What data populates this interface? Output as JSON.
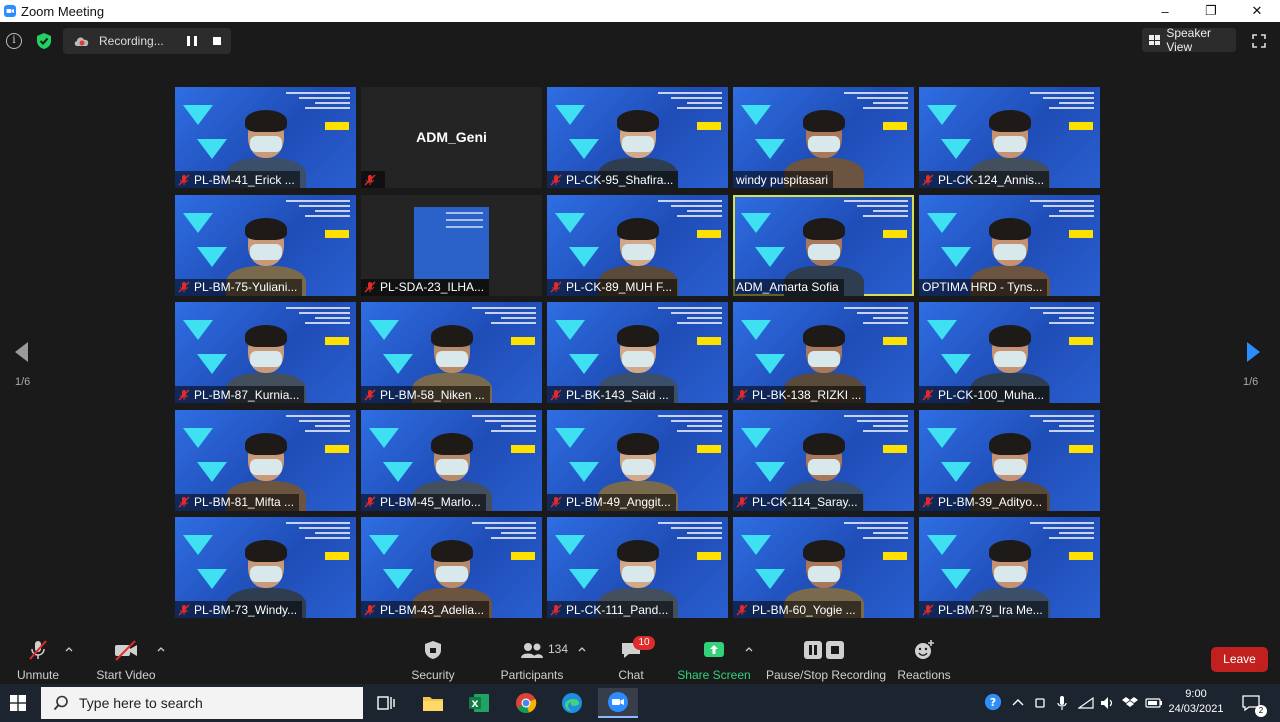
{
  "window": {
    "title": "Zoom Meeting",
    "controls": [
      "–",
      "❐",
      "✕"
    ]
  },
  "topbar": {
    "recording_label": "Recording...",
    "speaker_view_label": "Speaker View"
  },
  "gallery": {
    "page_left": "1/6",
    "page_right": "1/6",
    "tiles": [
      {
        "name": "PL-BM-41_Erick ...",
        "muted": true,
        "kind": "video"
      },
      {
        "name": "",
        "display_name": "ADM_Geni",
        "muted": true,
        "kind": "dark"
      },
      {
        "name": "PL-CK-95_Shafira...",
        "muted": true,
        "kind": "video"
      },
      {
        "name": "windy puspitasari",
        "muted": false,
        "kind": "video"
      },
      {
        "name": "PL-CK-124_Annis...",
        "muted": true,
        "kind": "video"
      },
      {
        "name": "PL-BM-75-Yuliani...",
        "muted": true,
        "kind": "video"
      },
      {
        "name": "PL-SDA-23_ILHA...",
        "muted": true,
        "kind": "dark-share"
      },
      {
        "name": "PL-CK-89_MUH F...",
        "muted": true,
        "kind": "video"
      },
      {
        "name": "ADM_Amarta Sofia",
        "muted": false,
        "kind": "video",
        "active": true
      },
      {
        "name": "OPTIMA HRD - Tyns...",
        "muted": false,
        "kind": "video"
      },
      {
        "name": "PL-BM-87_Kurnia...",
        "muted": true,
        "kind": "video"
      },
      {
        "name": "PL-BM-58_Niken ...",
        "muted": true,
        "kind": "video"
      },
      {
        "name": "PL-BK-143_Said ...",
        "muted": true,
        "kind": "video"
      },
      {
        "name": "PL-BK-138_RIZKI ...",
        "muted": true,
        "kind": "video"
      },
      {
        "name": "PL-CK-100_Muha...",
        "muted": true,
        "kind": "video"
      },
      {
        "name": "PL-BM-81_Mifta ...",
        "muted": true,
        "kind": "video"
      },
      {
        "name": "PL-BM-45_Marlo...",
        "muted": true,
        "kind": "video"
      },
      {
        "name": "PL-BM-49_Anggit...",
        "muted": true,
        "kind": "video"
      },
      {
        "name": "PL-CK-114_Saray...",
        "muted": true,
        "kind": "video"
      },
      {
        "name": "PL-BM-39_Adityo...",
        "muted": true,
        "kind": "video"
      },
      {
        "name": "PL-BM-73_Windy...",
        "muted": true,
        "kind": "video"
      },
      {
        "name": "PL-BM-43_Adelia...",
        "muted": true,
        "kind": "video"
      },
      {
        "name": "PL-CK-111_Pand...",
        "muted": true,
        "kind": "video"
      },
      {
        "name": "PL-BM-60_Yogie ...",
        "muted": true,
        "kind": "video"
      },
      {
        "name": "PL-BM-79_Ira Me...",
        "muted": true,
        "kind": "video"
      }
    ]
  },
  "toolbar": {
    "unmute": "Unmute",
    "start_video": "Start Video",
    "security": "Security",
    "participants": "Participants",
    "participants_count": "134",
    "chat": "Chat",
    "chat_badge": "10",
    "share_screen": "Share Screen",
    "pause_stop": "Pause/Stop Recording",
    "reactions": "Reactions",
    "leave": "Leave"
  },
  "taskbar": {
    "search_placeholder": "Type here to search",
    "time": "9:00",
    "date": "24/03/2021",
    "notification_count": "2"
  },
  "colors": {
    "accent_green": "#33d17a",
    "leave_red": "#c2201f",
    "active_speaker": "#d4e157"
  }
}
